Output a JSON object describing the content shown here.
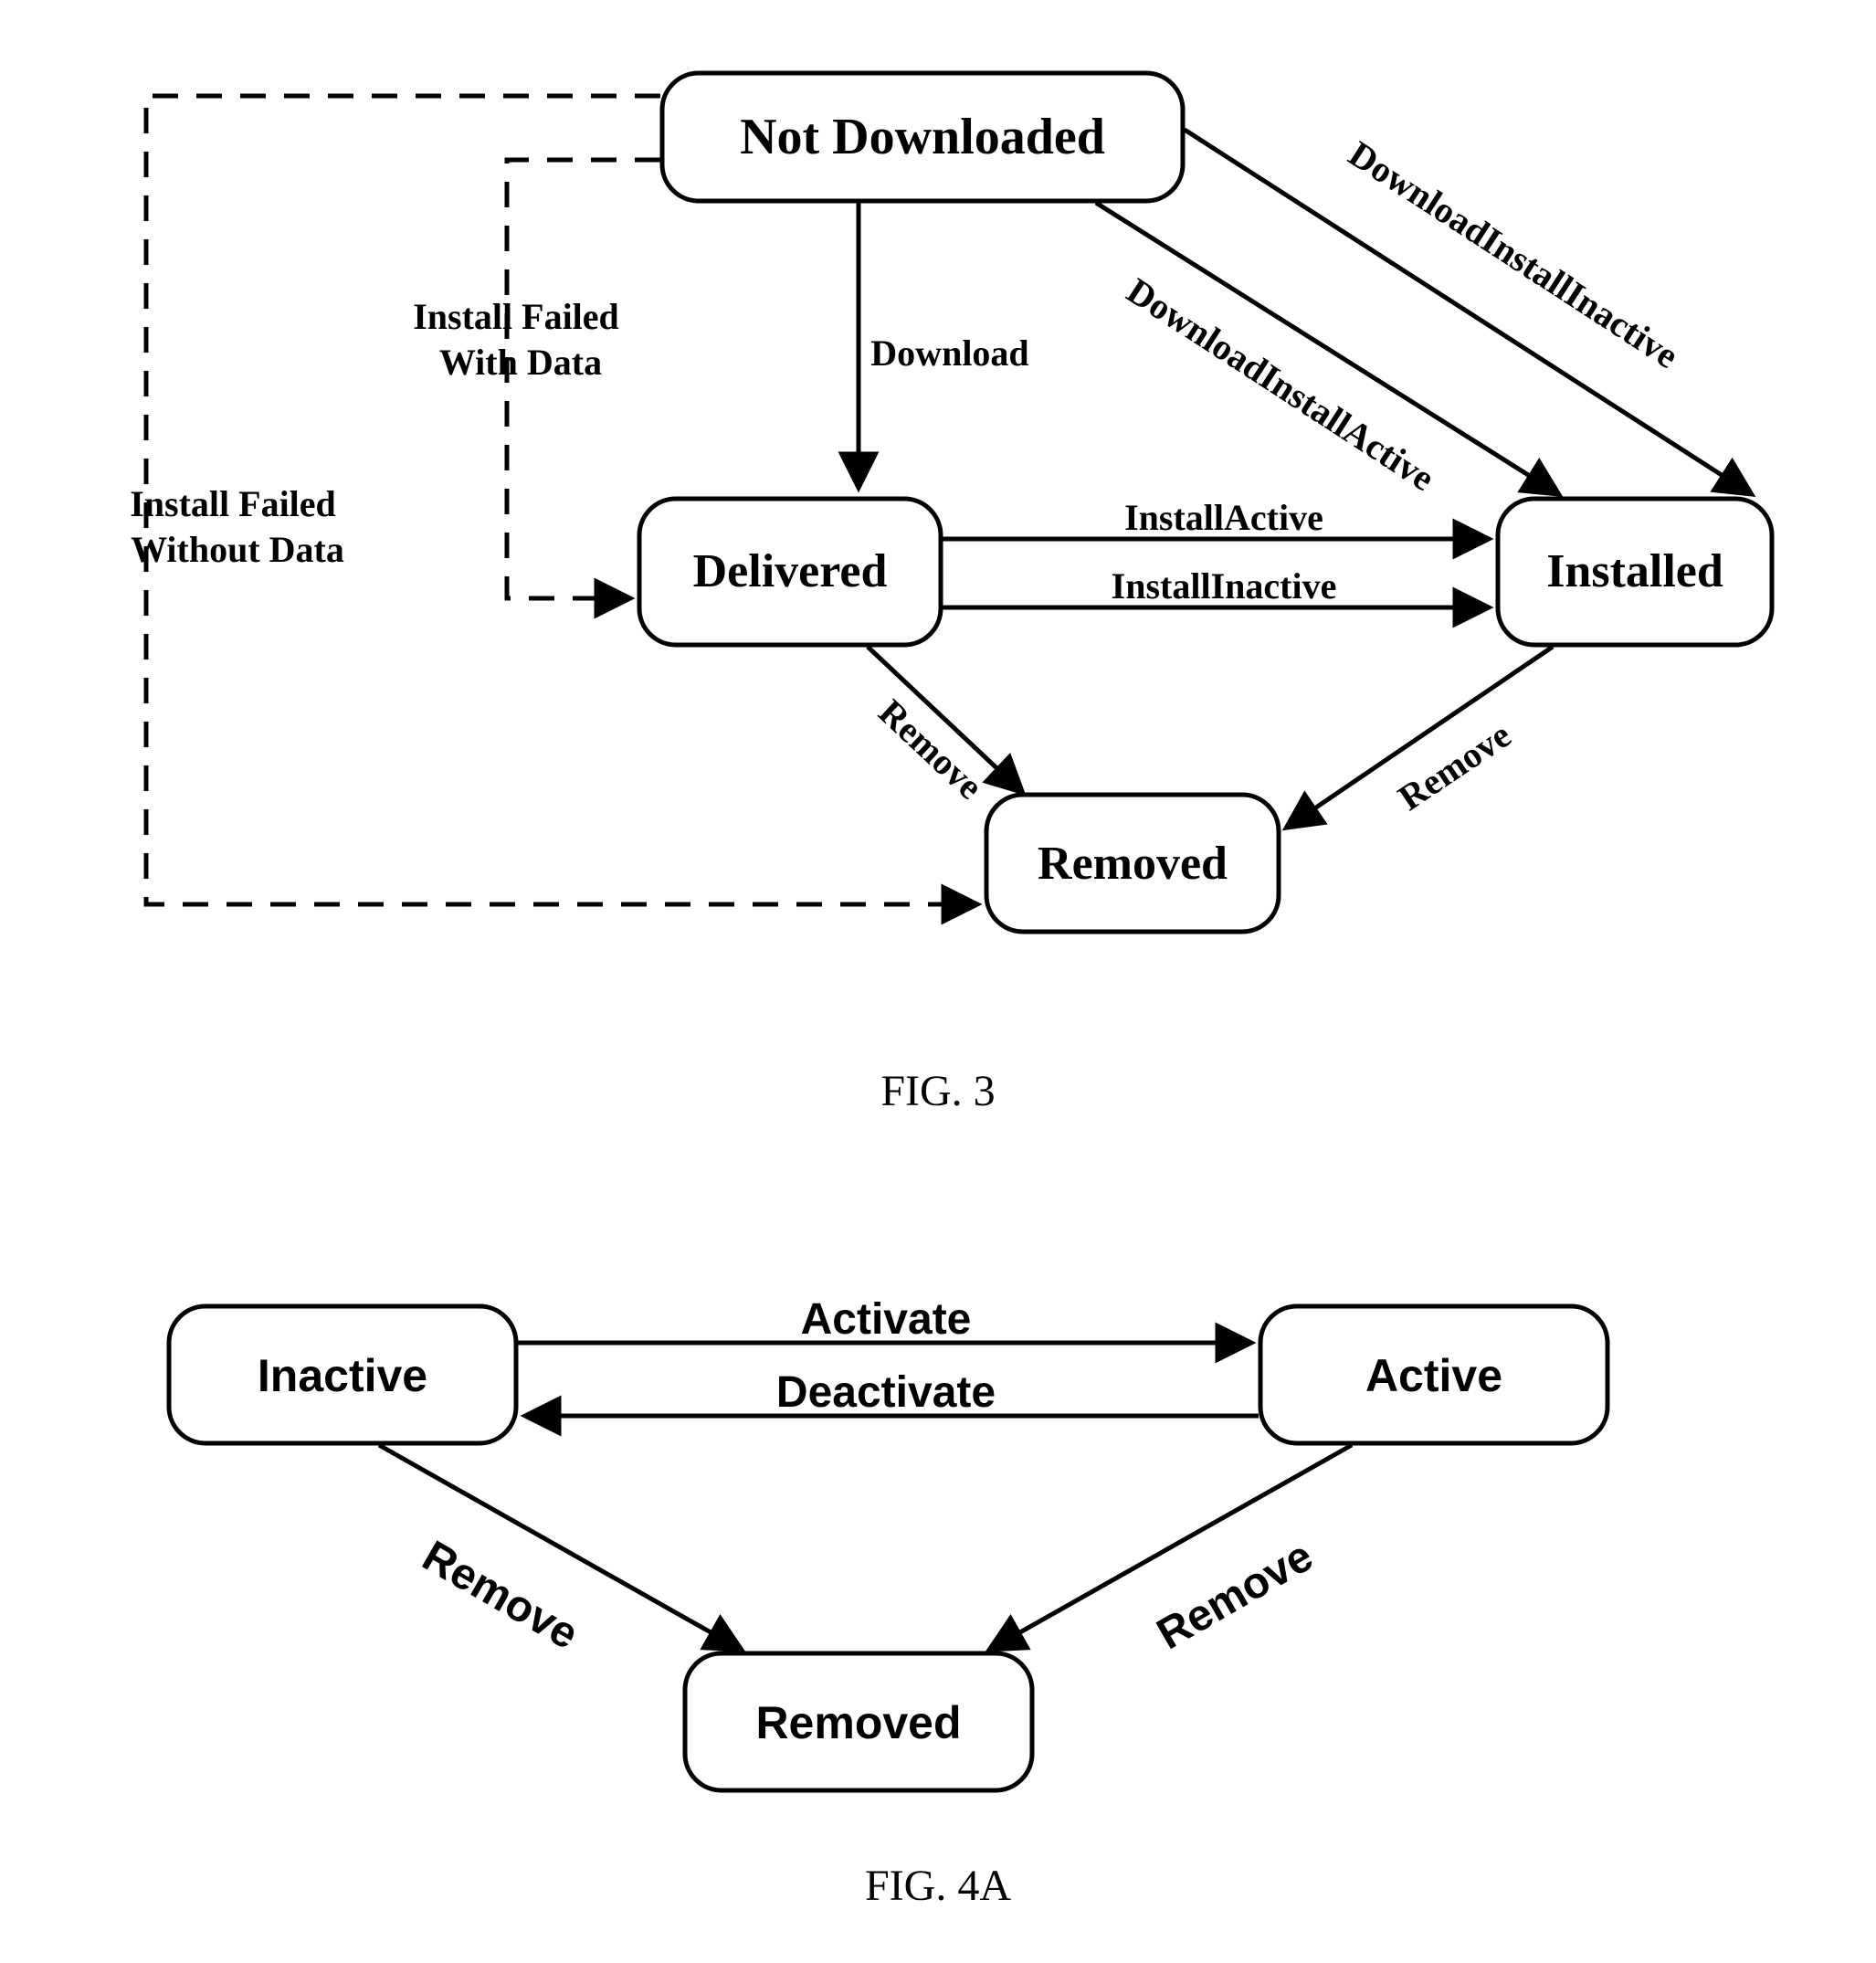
{
  "fig3": {
    "caption": "FIG. 3",
    "states": {
      "not_downloaded": "Not Downloaded",
      "delivered": "Delivered",
      "installed": "Installed",
      "removed": "Removed"
    },
    "edges": {
      "download": "Download",
      "download_install_inactive": "DownloadInstallInactive",
      "download_install_active": "DownloadInstallActive",
      "install_active": "InstallActive",
      "install_inactive": "InstallInactive",
      "remove_from_delivered": "Remove",
      "remove_from_installed": "Remove",
      "install_failed_with_data": "Install Failed\nWith Data",
      "install_failed_without_data": "Install Failed\nWithout Data"
    }
  },
  "fig4a": {
    "caption": "FIG. 4A",
    "states": {
      "inactive": "Inactive",
      "active": "Active",
      "removed": "Removed"
    },
    "edges": {
      "activate": "Activate",
      "deactivate": "Deactivate",
      "remove_from_inactive": "Remove",
      "remove_from_active": "Remove"
    }
  }
}
